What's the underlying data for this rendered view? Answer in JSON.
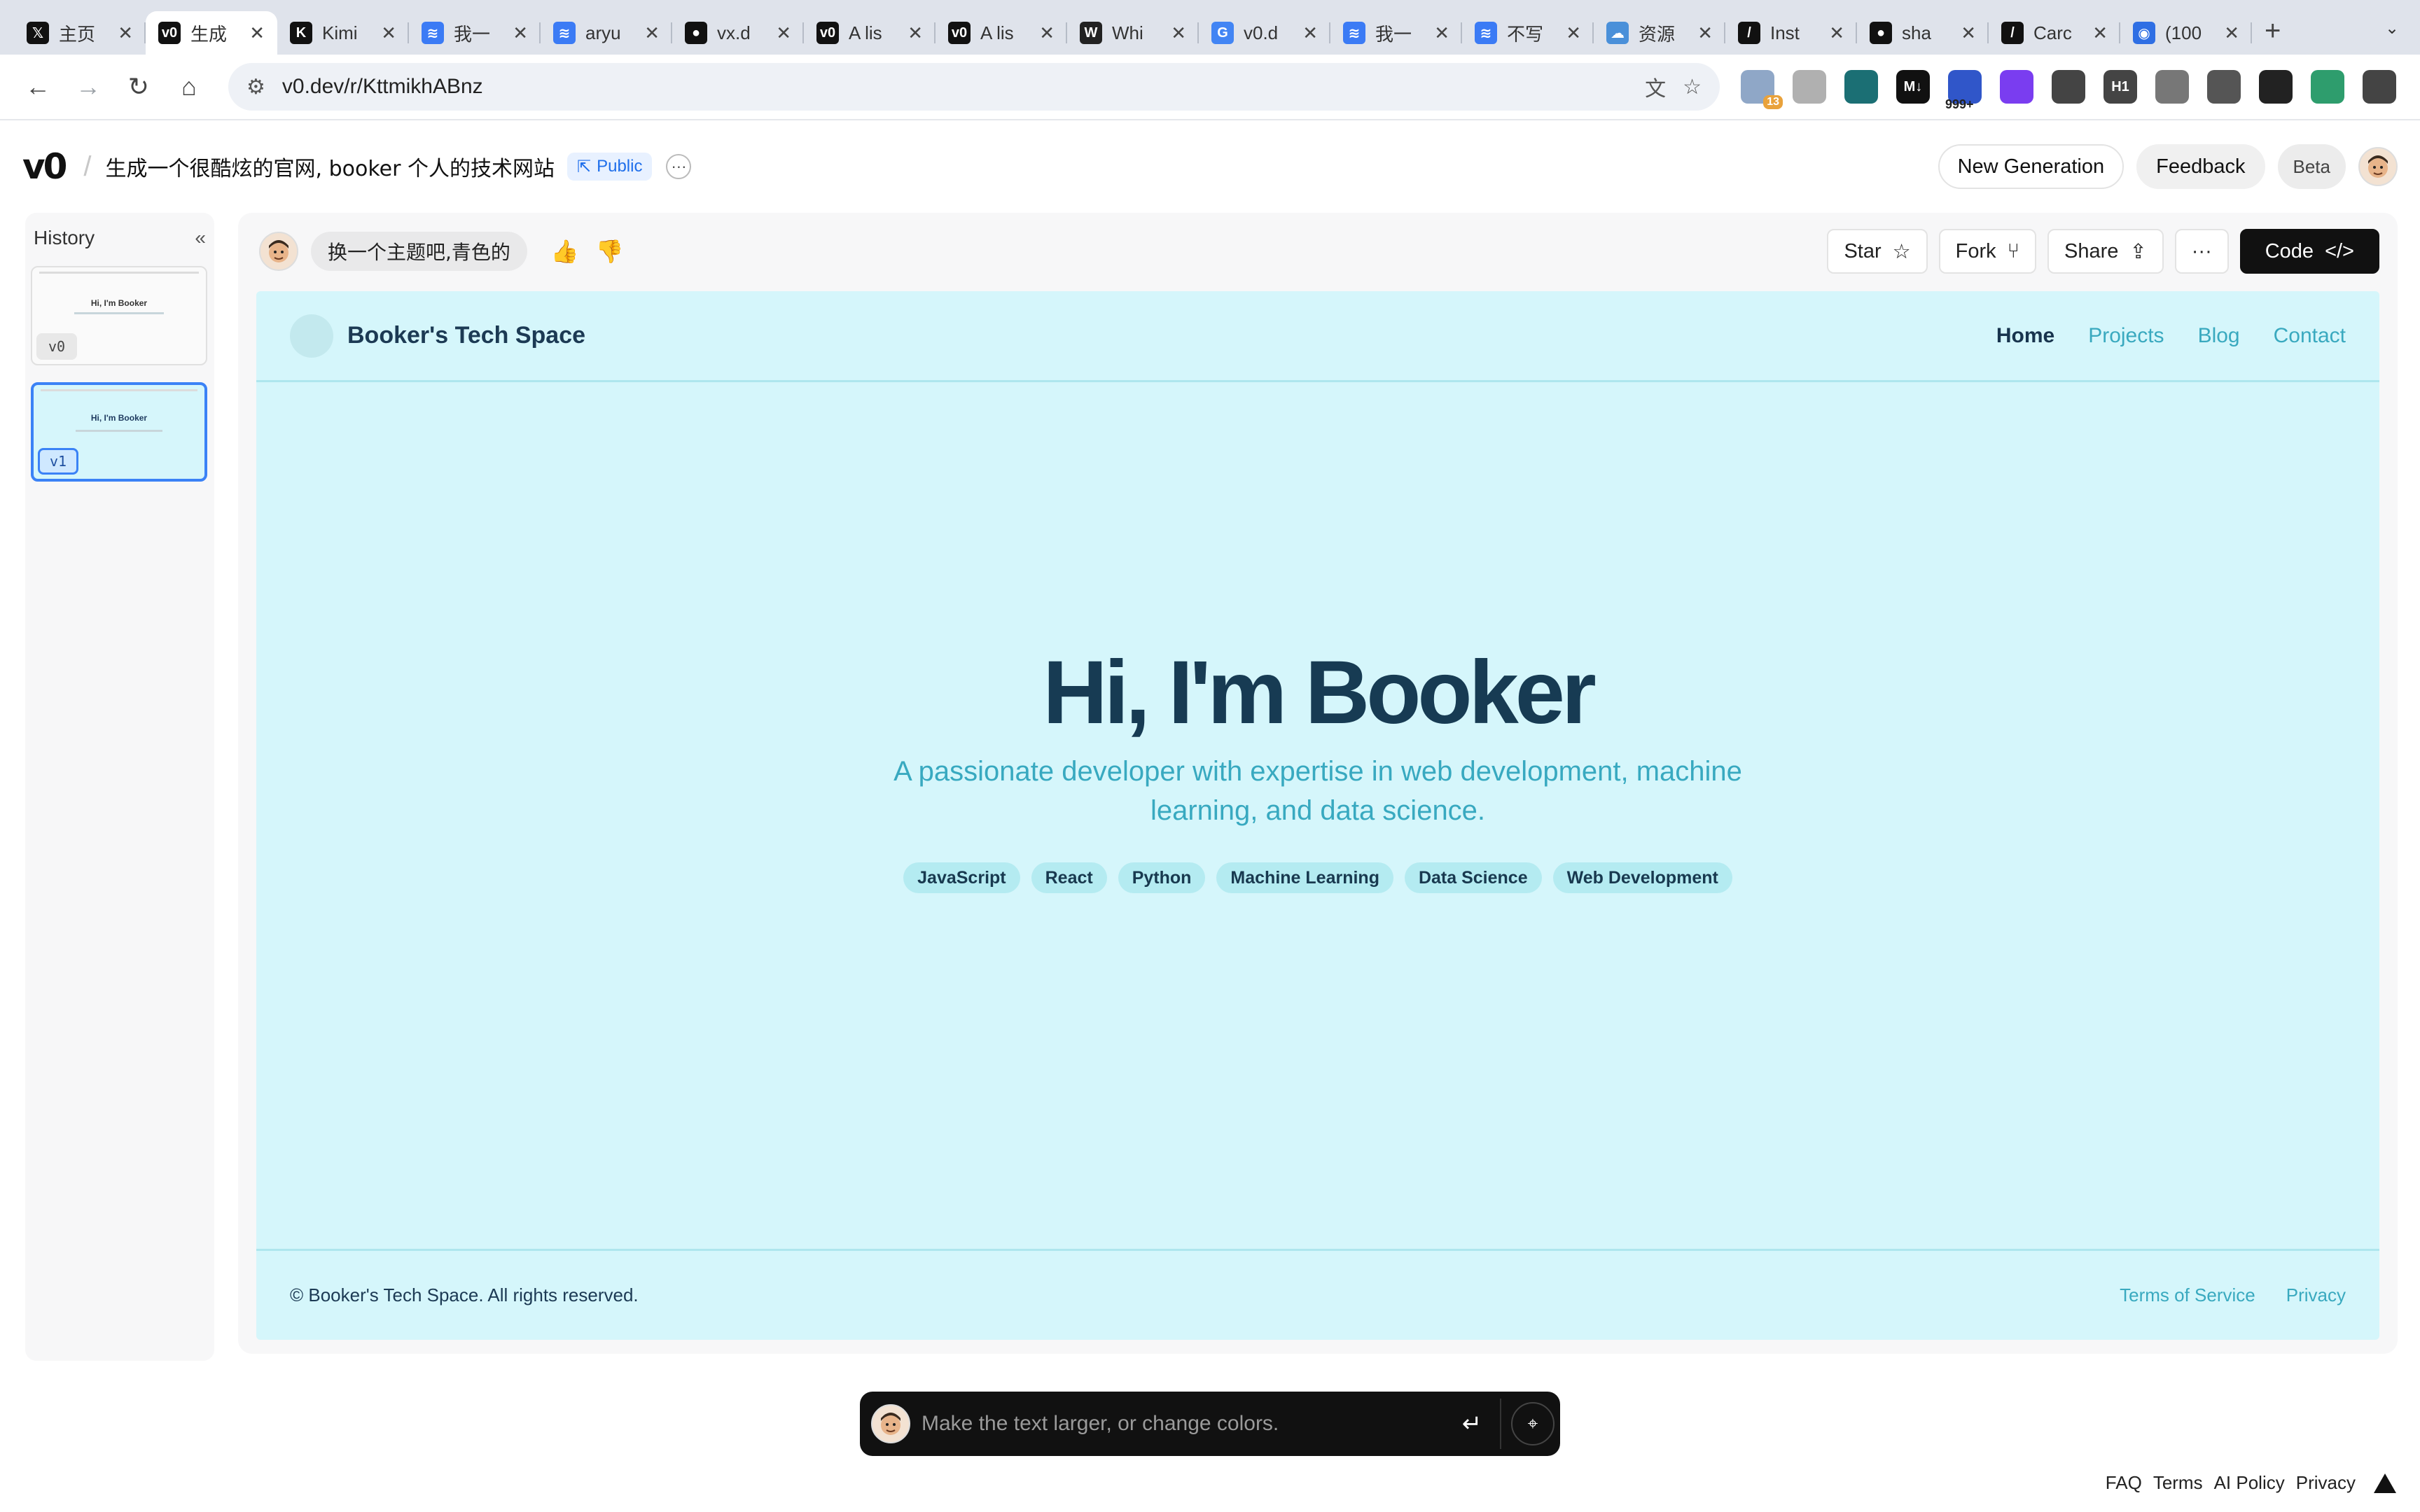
{
  "browser": {
    "tabs": [
      {
        "title": "主页",
        "icon": "x-icon",
        "color": "#111111",
        "glyph": "𝕏"
      },
      {
        "title": "生成",
        "icon": "v0-icon",
        "color": "#111111",
        "glyph": "v0",
        "active": true
      },
      {
        "title": "Kimi",
        "icon": "kimi-icon",
        "color": "#111111",
        "glyph": "K"
      },
      {
        "title": "我一",
        "icon": "stack-icon",
        "color": "#3b7bf5",
        "glyph": "≋"
      },
      {
        "title": "aryu",
        "icon": "stack-icon",
        "color": "#3b7bf5",
        "glyph": "≋"
      },
      {
        "title": "vx.d",
        "icon": "github-icon",
        "color": "#111111",
        "glyph": "●"
      },
      {
        "title": "A lis",
        "icon": "v0-icon",
        "color": "#111111",
        "glyph": "v0"
      },
      {
        "title": "A lis",
        "icon": "v0-icon",
        "color": "#111111",
        "glyph": "v0"
      },
      {
        "title": "Whi",
        "icon": "w-icon",
        "color": "#222222",
        "glyph": "W"
      },
      {
        "title": "v0.d",
        "icon": "google-icon",
        "color": "#4285f4",
        "glyph": "G"
      },
      {
        "title": "我一",
        "icon": "stack-icon",
        "color": "#3b7bf5",
        "glyph": "≋"
      },
      {
        "title": "不写",
        "icon": "stack-icon",
        "color": "#3b7bf5",
        "glyph": "≋"
      },
      {
        "title": "资源",
        "icon": "cloud-icon",
        "color": "#4a90d9",
        "glyph": "☁"
      },
      {
        "title": "Inst",
        "icon": "slash-icon",
        "color": "#111111",
        "glyph": "/"
      },
      {
        "title": "sha",
        "icon": "github-icon",
        "color": "#111111",
        "glyph": "●"
      },
      {
        "title": "Carc",
        "icon": "slash-icon",
        "color": "#111111",
        "glyph": "/"
      },
      {
        "title": "(100",
        "icon": "app-icon",
        "color": "#2f6fe4",
        "glyph": "◉"
      }
    ],
    "new_tab": "+",
    "close_glyph": "✕",
    "dropdown_glyph": "⌄",
    "url": "v0.dev/r/KttmikhABnz",
    "extensions": [
      {
        "icon": "search-ext-icon",
        "color": "#8fa7c7",
        "badge": "13"
      },
      {
        "icon": "copy-ext-icon",
        "color": "#b0b0b0"
      },
      {
        "icon": "book-ext-icon",
        "color": "#1b6f74"
      },
      {
        "icon": "md-ext-icon",
        "color": "#111111",
        "text": "M↓"
      },
      {
        "icon": "counter-ext-icon",
        "color": "#3056c9",
        "badge2": "999+"
      },
      {
        "icon": "purple-ext-icon",
        "color": "#7a3df0"
      },
      {
        "icon": "reader-ext-icon",
        "color": "#444444"
      },
      {
        "icon": "h1-ext-icon",
        "color": "#444444",
        "text": "H1"
      },
      {
        "icon": "h-ext-icon",
        "color": "#777777"
      },
      {
        "icon": "puzzle-icon",
        "color": "#555555"
      },
      {
        "icon": "sidepanel-icon",
        "color": "#222222"
      },
      {
        "icon": "profile-icon",
        "color": "#2e9d6d"
      },
      {
        "icon": "menu-icon",
        "color": "#444444"
      }
    ]
  },
  "header": {
    "logo": "v0",
    "title": "生成一个很酷炫的官网, booker 个人的技术网站",
    "public_label": "Public",
    "more": "···",
    "new_generation": "New Generation",
    "feedback": "Feedback",
    "beta": "Beta"
  },
  "history": {
    "title": "History",
    "collapse": "«",
    "versions": [
      {
        "label": "v0",
        "preview_title": "Hi, I'm Booker"
      },
      {
        "label": "v1",
        "preview_title": "Hi, I'm Booker",
        "selected": true
      }
    ]
  },
  "prompt": {
    "text": "换一个主题吧,青色的",
    "like": "👍",
    "dislike": "👎"
  },
  "actions": {
    "star": "Star",
    "fork": "Fork",
    "share": "Share",
    "more": "···",
    "code": "Code"
  },
  "site": {
    "name": "Booker's Tech Space",
    "nav": [
      {
        "label": "Home",
        "active": true
      },
      {
        "label": "Projects"
      },
      {
        "label": "Blog"
      },
      {
        "label": "Contact"
      }
    ],
    "hero_title": "Hi, I'm Booker",
    "hero_subtitle": "A passionate developer with expertise in web development, machine learning, and data science.",
    "tags": [
      "JavaScript",
      "React",
      "Python",
      "Machine Learning",
      "Data Science",
      "Web Development"
    ],
    "copyright": "© Booker's Tech Space. All rights reserved.",
    "footer_links": [
      "Terms of Service",
      "Privacy"
    ],
    "colors": {
      "background": "#d5f6fb",
      "heading": "#173b53",
      "accent": "#39a9bf"
    }
  },
  "chat": {
    "placeholder": "Make the text larger, or change colors.",
    "enter": "↵",
    "picker": "⌖"
  },
  "footer": {
    "links": [
      "FAQ",
      "Terms",
      "AI Policy",
      "Privacy"
    ]
  }
}
